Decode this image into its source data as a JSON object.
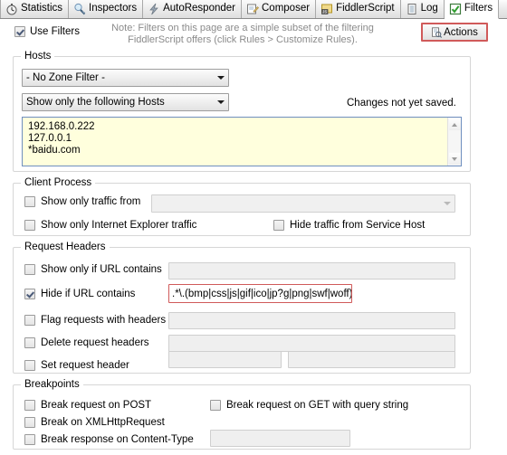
{
  "tabs": [
    {
      "label": "Statistics",
      "icon": "stopwatch-icon",
      "active": false
    },
    {
      "label": "Inspectors",
      "icon": "magnifier-icon",
      "active": false
    },
    {
      "label": "AutoResponder",
      "icon": "lightning-icon",
      "active": false
    },
    {
      "label": "Composer",
      "icon": "pencil-note-icon",
      "active": false
    },
    {
      "label": "FiddlerScript",
      "icon": "js-scroll-icon",
      "active": false
    },
    {
      "label": "Log",
      "icon": "document-icon",
      "active": false
    },
    {
      "label": "Filters",
      "icon": "green-check-icon",
      "active": true
    }
  ],
  "toolbar": {
    "use_filters_label": "Use Filters",
    "use_filters_checked": true,
    "note_line1": "Note: Filters on this page are a simple subset of the filtering",
    "note_line2": "FiddlerScript offers (click Rules > Customize Rules).",
    "actions_label": "Actions",
    "actions_icon": "actions-page-icon",
    "actions_highlight_color": "#d05a5a"
  },
  "hosts": {
    "legend": "Hosts",
    "zone_filter_value": "- No Zone Filter -",
    "host_mode_value": "Show only the following Hosts",
    "status_text": "Changes not yet saved.",
    "host_list": [
      "192.168.0.222",
      "127.0.0.1",
      "*baidu.com"
    ],
    "textarea_bg": "#ffffdd"
  },
  "client_process": {
    "legend": "Client Process",
    "show_only_traffic_from_label": "Show only traffic from",
    "show_only_traffic_from_checked": false,
    "process_value": "",
    "show_only_ie_label": "Show only Internet Explorer traffic",
    "show_only_ie_checked": false,
    "hide_service_host_label": "Hide traffic from Service Host",
    "hide_service_host_checked": false
  },
  "request_headers": {
    "legend": "Request Headers",
    "show_only_if_url_label": "Show only if URL contains",
    "show_only_if_url_checked": false,
    "show_only_if_url_value": "",
    "hide_if_url_label": "Hide if URL contains",
    "hide_if_url_checked": true,
    "hide_if_url_value": ".*\\.(bmp|css|js|gif|ico|jp?g|png|swf|woff)",
    "flag_requests_label": "Flag requests with headers",
    "flag_requests_checked": false,
    "flag_requests_value": "",
    "delete_headers_label": "Delete request headers",
    "delete_headers_checked": false,
    "delete_headers_value": "",
    "set_header_label": "Set request header",
    "set_header_checked": false,
    "set_header_name_value": "",
    "set_header_value_value": ""
  },
  "breakpoints": {
    "legend": "Breakpoints",
    "break_post_label": "Break request on POST",
    "break_post_checked": false,
    "break_get_query_label": "Break request on GET with query string",
    "break_get_query_checked": false,
    "break_xhr_label": "Break on XMLHttpRequest",
    "break_xhr_checked": false,
    "break_content_type_label": "Break response on Content-Type",
    "break_content_type_checked": false,
    "break_content_type_value": ""
  }
}
